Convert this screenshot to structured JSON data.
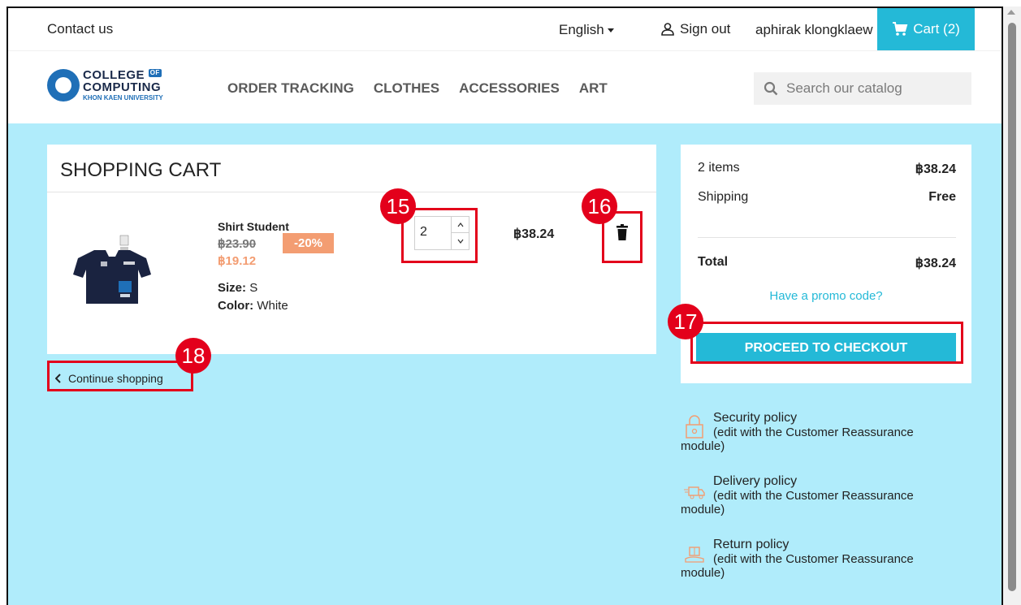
{
  "topbar": {
    "contact": "Contact us",
    "language": "English",
    "sign_out": "Sign out",
    "username": "aphirak klongklaew",
    "cart_label": "Cart (2)"
  },
  "header": {
    "logo_line1": "COLLEGE",
    "logo_of": "OF",
    "logo_line2": "COMPUTING",
    "logo_line3": "KHON KAEN UNIVERSITY",
    "nav": [
      "ORDER TRACKING",
      "CLOTHES",
      "ACCESSORIES",
      "ART"
    ],
    "search_placeholder": "Search our catalog"
  },
  "cart": {
    "title": "SHOPPING CART",
    "item": {
      "name": "Shirt Student",
      "old_price": "฿23.90",
      "discount": "-20%",
      "new_price": "฿19.12",
      "size_label": "Size:",
      "size_value": "S",
      "color_label": "Color:",
      "color_value": "White",
      "quantity": "2",
      "line_total": "฿38.24"
    },
    "continue": "Continue shopping"
  },
  "summary": {
    "items_label": "2 items",
    "items_value": "฿38.24",
    "shipping_label": "Shipping",
    "shipping_value": "Free",
    "total_label": "Total",
    "total_value": "฿38.24",
    "promo": "Have a promo code?",
    "checkout": "PROCEED TO CHECKOUT"
  },
  "reassurance": [
    {
      "title": "Security policy",
      "desc": "(edit with the Customer Reassurance",
      "tail": "module)"
    },
    {
      "title": "Delivery policy",
      "desc": "(edit with the Customer Reassurance",
      "tail": "module)"
    },
    {
      "title": "Return policy",
      "desc": "(edit with the Customer Reassurance",
      "tail": "module)"
    }
  ],
  "annotations": {
    "qty": "15",
    "delete": "16",
    "checkout": "17",
    "continue": "18"
  },
  "colors": {
    "accent": "#24b9d7",
    "background": "#b0ecfb",
    "discount": "#f39d72",
    "annotation": "#e3001b"
  }
}
